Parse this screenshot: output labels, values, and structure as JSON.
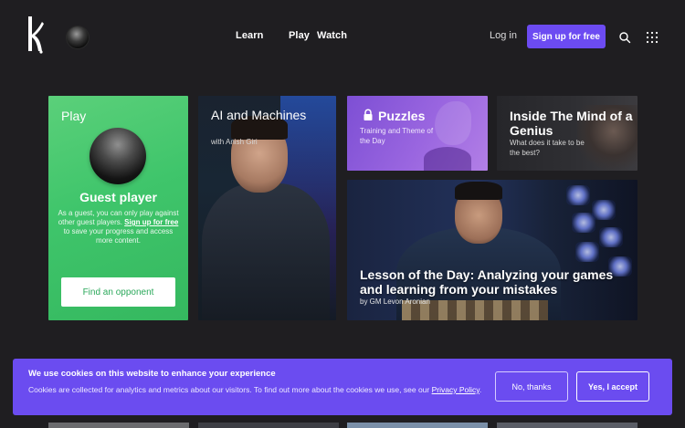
{
  "header": {
    "nav": [
      "Learn",
      "Play",
      "Watch"
    ],
    "login_label": "Log in",
    "signup_label": "Sign up for free",
    "icons": {
      "logo": "kasparovchess-logo",
      "search": "search-icon",
      "menu": "grid-menu-icon"
    }
  },
  "cards": {
    "guest": {
      "section_label": "Play",
      "title": "Guest player",
      "desc_before": "As a guest, you can only play against other guest players. ",
      "desc_link": "Sign up for free",
      "desc_after": " to save your progress and access more content.",
      "button_label": "Find an opponent",
      "color": "#3fc56b"
    },
    "ai": {
      "title": "AI and Machines",
      "subtitle": "with Anish Giri"
    },
    "puzzles": {
      "title": "Puzzles",
      "subtitle": "Training and Theme of the Day",
      "icon": "lock-icon",
      "color": "#9a66e0"
    },
    "genius": {
      "title": "Inside The Mind of a Genius",
      "subtitle": "What does it take to be the best?"
    },
    "lesson": {
      "title": "Lesson of the Day: Analyzing your games and learning from your mistakes",
      "subtitle": "by GM Levon Aronian"
    }
  },
  "cookie": {
    "title": "We use cookies on this website to enhance your experience",
    "text": "Cookies are collected for analytics and metrics about our visitors. To find out more about the cookies we use, see our ",
    "link": "Privacy Policy",
    "text_end": ".",
    "decline_label": "No, thanks",
    "accept_label": "Yes, I accept",
    "color": "#6b4cf0"
  }
}
